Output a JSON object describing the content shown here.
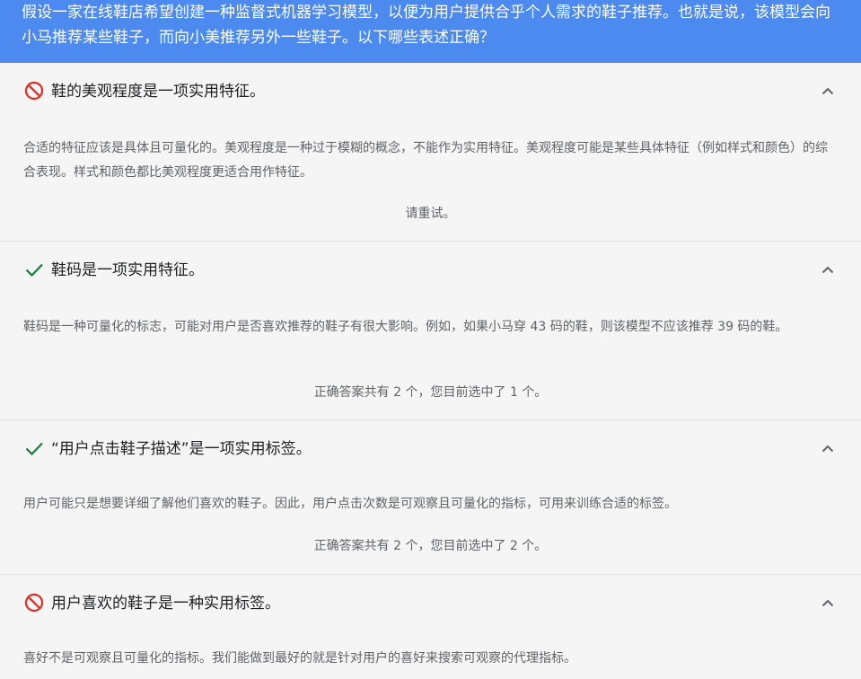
{
  "question": {
    "text": "假设一家在线鞋店希望创建一种监督式机器学习模型，以便为用户提供合乎个人需求的鞋子推荐。也就是说，该模型会向小马推荐某些鞋子，而向小美推荐另外一些鞋子。以下哪些表述正确？"
  },
  "colors": {
    "header_bg": "#4c8af0",
    "correct": "#188038",
    "incorrect": "#d93025"
  },
  "options": [
    {
      "status": "incorrect",
      "icon": "prohibited-icon",
      "title": "鞋的美观程度是一项实用特征。",
      "explanation": "合适的特征应该是具体且可量化的。美观程度是一种过于模糊的概念，不能作为实用特征。美观程度可能是某些具体特征（例如样式和颜色）的综合表现。样式和颜色都比美观程度更适合用作特征。",
      "feedback": "请重试。"
    },
    {
      "status": "correct",
      "icon": "checkmark-icon",
      "title": "鞋码是一项实用特征。",
      "explanation": "鞋码是一种可量化的标志，可能对用户是否喜欢推荐的鞋子有很大影响。例如，如果小马穿 43 码的鞋，则该模型不应该推荐 39 码的鞋。",
      "feedback": "正确答案共有 2 个，您目前选中了 1 个。"
    },
    {
      "status": "correct",
      "icon": "checkmark-icon",
      "title": "“用户点击鞋子描述”是一项实用标签。",
      "explanation": "用户可能只是想要详细了解他们喜欢的鞋子。因此，用户点击次数是可观察且可量化的指标，可用来训练合适的标签。",
      "feedback": "正确答案共有 2 个，您目前选中了 2 个。"
    },
    {
      "status": "incorrect",
      "icon": "prohibited-icon",
      "title": "用户喜欢的鞋子是一种实用标签。",
      "explanation": "喜好不是可观察且可量化的指标。我们能做到最好的就是针对用户的喜好来搜索可观察的代理指标。"
    }
  ]
}
